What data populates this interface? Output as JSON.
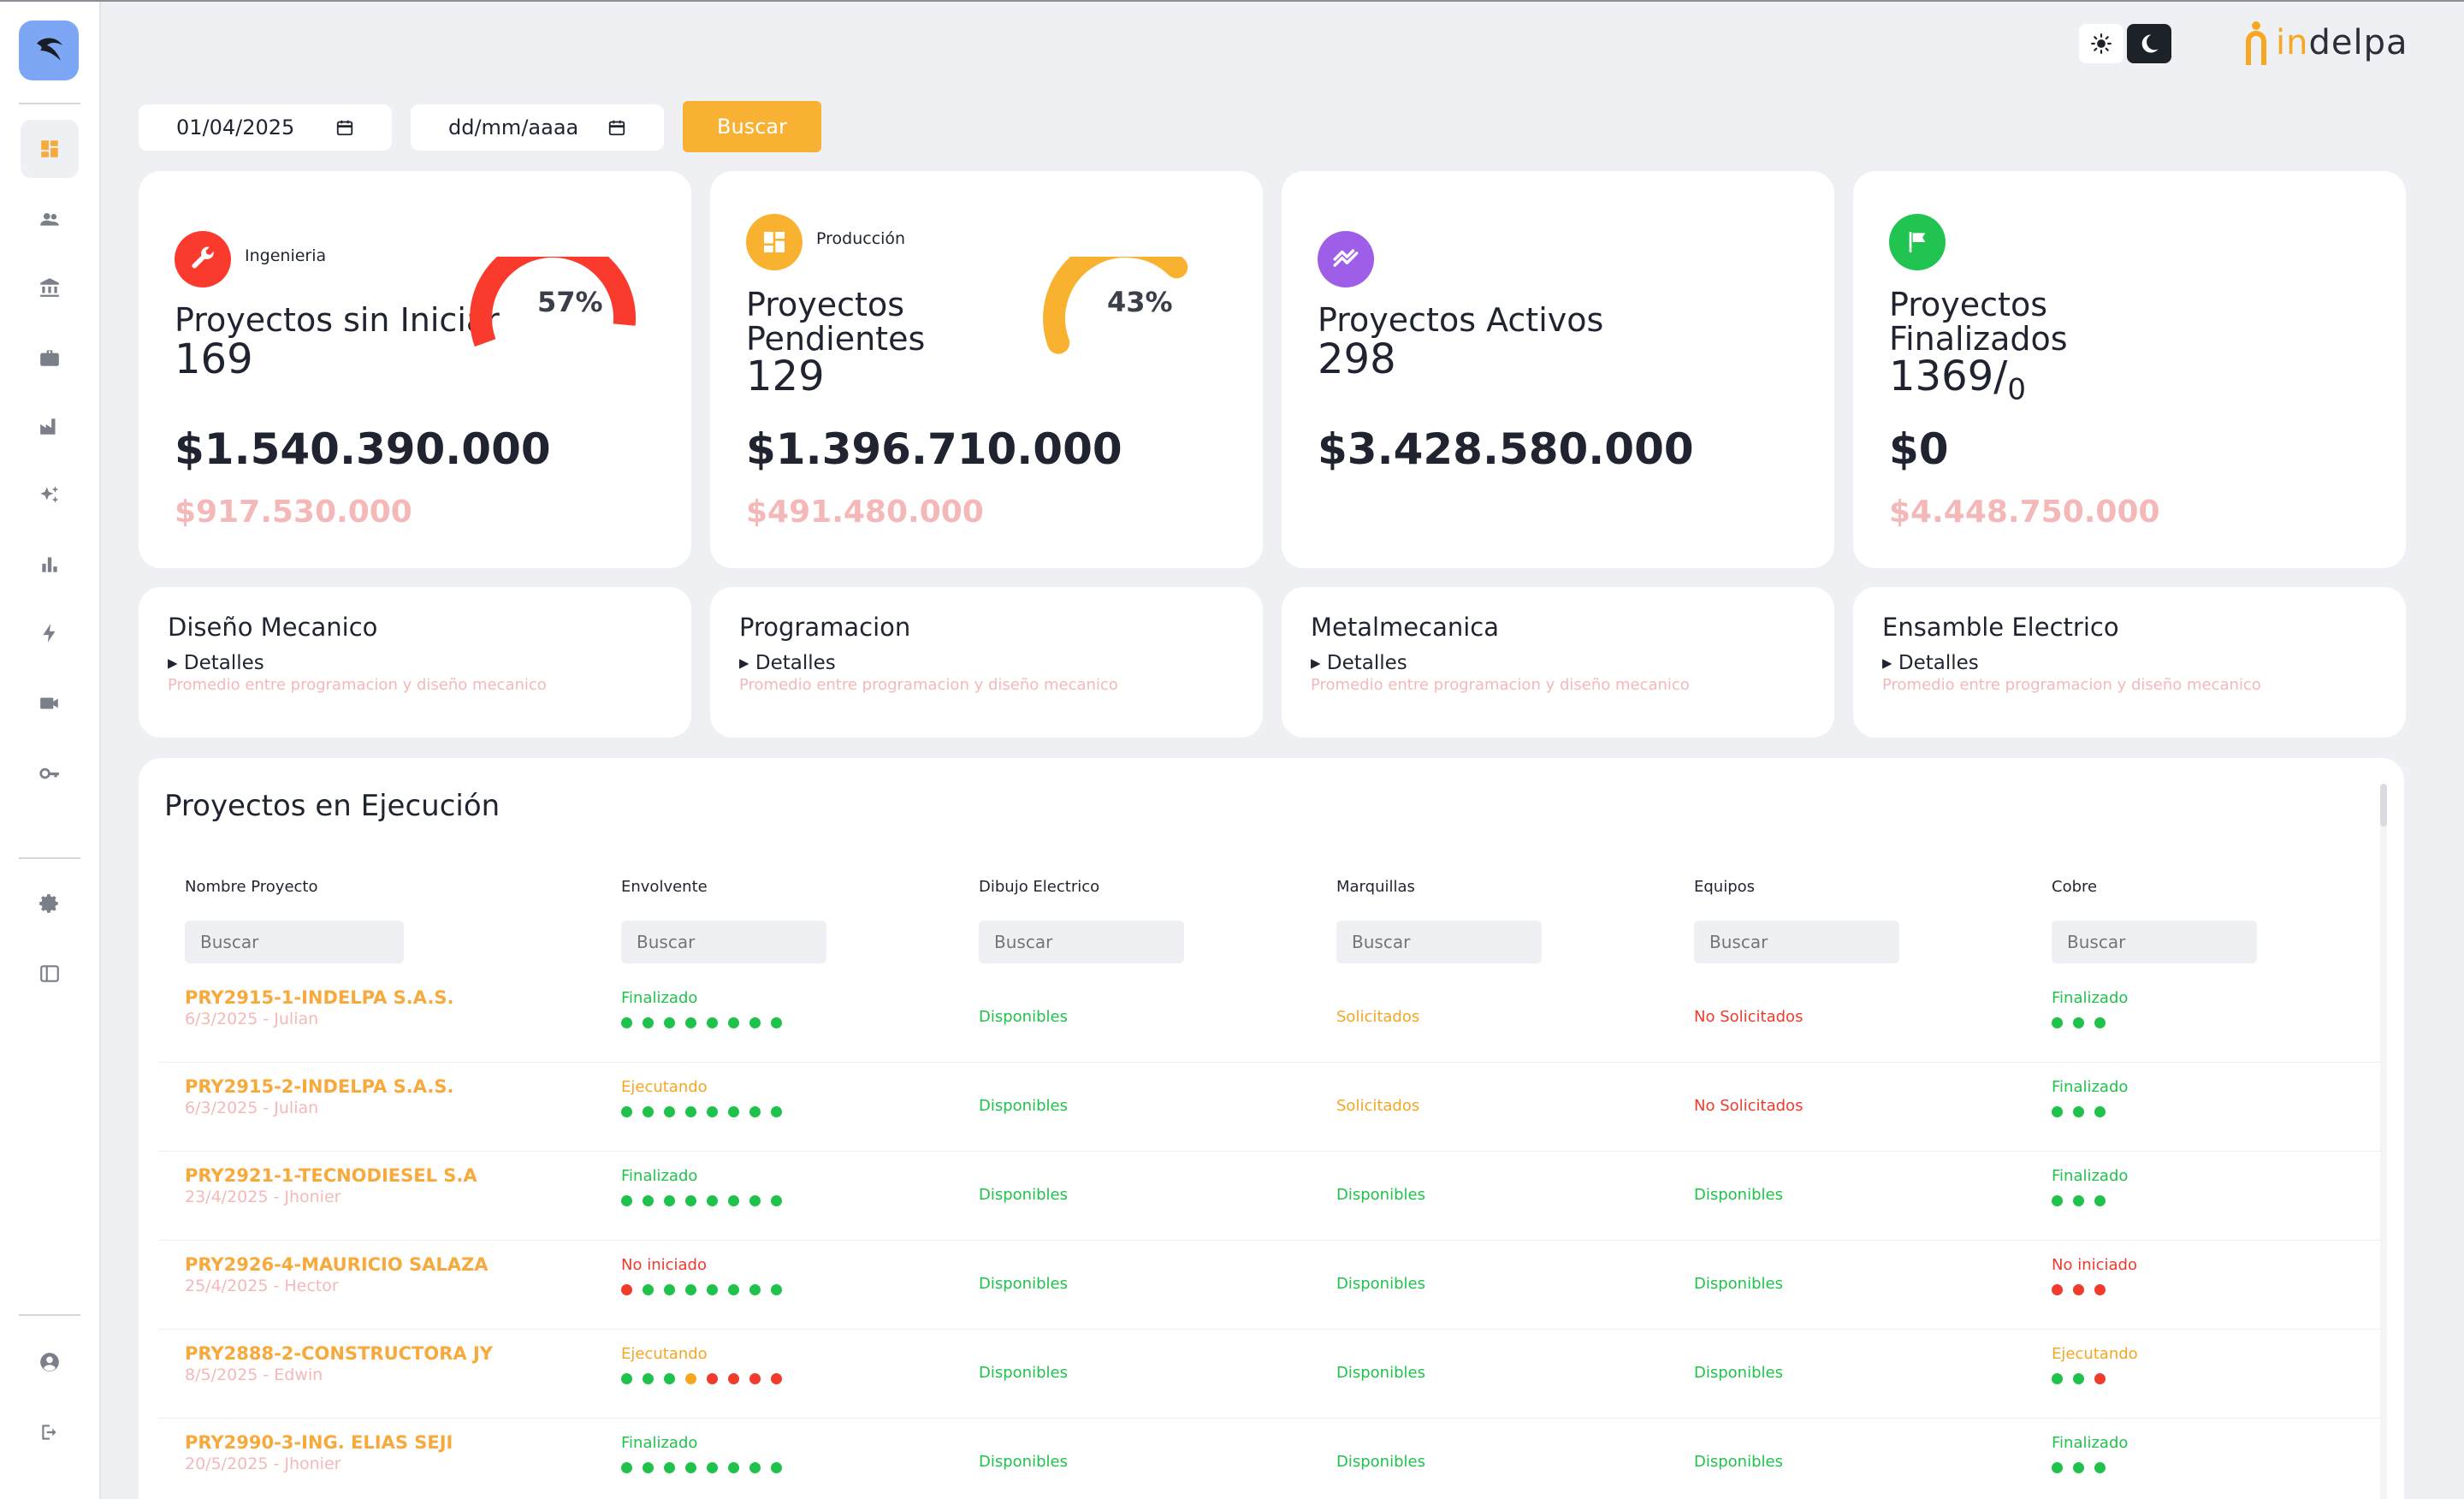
{
  "sidebar": {
    "logo_icon": "bird-logo-icon",
    "items": [
      {
        "icon": "dashboard-icon",
        "active": true
      },
      {
        "icon": "users-icon"
      },
      {
        "icon": "bank-icon"
      },
      {
        "icon": "briefcase-icon"
      },
      {
        "icon": "factory-icon"
      },
      {
        "icon": "sparkles-icon"
      },
      {
        "icon": "bar-chart-icon"
      },
      {
        "icon": "lightning-icon"
      },
      {
        "icon": "video-icon"
      },
      {
        "icon": "key-icon"
      },
      {
        "icon": "settings-icon"
      },
      {
        "icon": "sidebar-toggle-icon"
      },
      {
        "icon": "account-icon"
      },
      {
        "icon": "logout-icon"
      }
    ]
  },
  "header": {
    "brand_in": "in",
    "brand_rest": "delpa"
  },
  "filters": {
    "date_from": "01/04/2025",
    "date_to": "dd/mm/aaaa",
    "search_label": "Buscar"
  },
  "kpis": [
    {
      "category": "Ingenieria",
      "title": "Proyectos sin Iniciar",
      "count": "169",
      "amount": "$1.540.390.000",
      "sub": "$917.530.000",
      "percent": "57%",
      "color": "#fb3a2e",
      "icon": "wrench-icon"
    },
    {
      "category": "Producción",
      "title": "Proyectos Pendientes",
      "count": "129",
      "amount": "$1.396.710.000",
      "sub": "$491.480.000",
      "percent": "43%",
      "color": "#f9b130",
      "icon": "dashboard-icon"
    },
    {
      "title": "Proyectos Activos",
      "count": "298",
      "amount": "$3.428.580.000",
      "color": "#9f5ee8",
      "icon": "trend-icon"
    },
    {
      "title": "Proyectos Finalizados",
      "count": "1369/",
      "count_sub": "0",
      "amount": "$0",
      "sub": "$4.448.750.000",
      "color": "#21c451",
      "icon": "flag-icon"
    }
  ],
  "areas": [
    {
      "name": "Diseño Mecanico",
      "details": "Detalles",
      "note": "Promedio entre programacion y diseño mecanico"
    },
    {
      "name": "Programacion",
      "details": "Detalles",
      "note": "Promedio entre programacion y diseño mecanico"
    },
    {
      "name": "Metalmecanica",
      "details": "Detalles",
      "note": "Promedio entre programacion y diseño mecanico"
    },
    {
      "name": "Ensamble Electrico",
      "details": "Detalles",
      "note": "Promedio entre programacion y diseño mecanico"
    }
  ],
  "table": {
    "title": "Proyectos en Ejecución",
    "search_placeholder": "Buscar",
    "columns": [
      "Nombre Proyecto",
      "Envolvente",
      "Dibujo Electrico",
      "Marquillas",
      "Equipos",
      "Cobre"
    ],
    "rows": [
      {
        "name": "PRY2915-1-INDELPA S.A.S.",
        "date": "6/3/2025 - Julian",
        "envolvente": "Finalizado",
        "env_dots": [
          "g",
          "g",
          "g",
          "g",
          "g",
          "g",
          "g",
          "g"
        ],
        "dibujo": "Disponibles",
        "marquillas": "Solicitados",
        "equipos": "No Solicitados",
        "cobre": "Finalizado",
        "cobre_dots": [
          "g",
          "g",
          "g"
        ]
      },
      {
        "name": "PRY2915-2-INDELPA S.A.S.",
        "date": "6/3/2025 - Julian",
        "envolvente": "Ejecutando",
        "env_dots": [
          "g",
          "g",
          "g",
          "g",
          "g",
          "g",
          "g",
          "g"
        ],
        "dibujo": "Disponibles",
        "marquillas": "Solicitados",
        "equipos": "No Solicitados",
        "cobre": "Finalizado",
        "cobre_dots": [
          "g",
          "g",
          "g"
        ]
      },
      {
        "name": "PRY2921-1-TECNODIESEL S.A",
        "date": "23/4/2025 - Jhonier",
        "envolvente": "Finalizado",
        "env_dots": [
          "g",
          "g",
          "g",
          "g",
          "g",
          "g",
          "g",
          "g"
        ],
        "dibujo": "Disponibles",
        "marquillas": "Disponibles",
        "equipos": "Disponibles",
        "cobre": "Finalizado",
        "cobre_dots": [
          "g",
          "g",
          "g"
        ]
      },
      {
        "name": "PRY2926-4-MAURICIO SALAZA",
        "date": "25/4/2025 - Hector",
        "envolvente": "No iniciado",
        "env_dots": [
          "r",
          "g",
          "g",
          "g",
          "g",
          "g",
          "g",
          "g"
        ],
        "dibujo": "Disponibles",
        "marquillas": "Disponibles",
        "equipos": "Disponibles",
        "cobre": "No iniciado",
        "cobre_dots": [
          "r",
          "r",
          "r"
        ]
      },
      {
        "name": "PRY2888-2-CONSTRUCTORA JY",
        "date": "8/5/2025 - Edwin",
        "envolvente": "Ejecutando",
        "env_dots": [
          "g",
          "g",
          "g",
          "o",
          "r",
          "r",
          "r",
          "r"
        ],
        "dibujo": "Disponibles",
        "marquillas": "Disponibles",
        "equipos": "Disponibles",
        "cobre": "Ejecutando",
        "cobre_dots": [
          "g",
          "g",
          "r"
        ]
      },
      {
        "name": "PRY2990-3-ING. ELIAS SEJI",
        "date": "20/5/2025 - Jhonier",
        "envolvente": "Finalizado",
        "env_dots": [
          "g",
          "g",
          "g",
          "g",
          "g",
          "g",
          "g",
          "g"
        ],
        "dibujo": "Disponibles",
        "marquillas": "Disponibles",
        "equipos": "Disponibles",
        "cobre": "Finalizado",
        "cobre_dots": [
          "g",
          "g",
          "g"
        ]
      }
    ]
  }
}
